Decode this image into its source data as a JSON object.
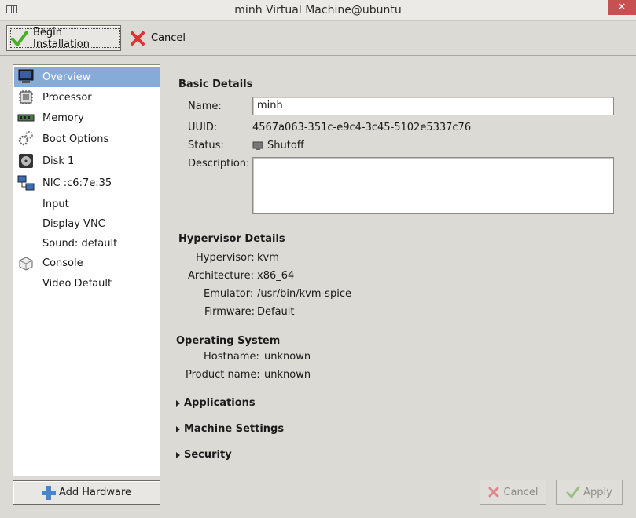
{
  "window": {
    "title": "minh Virtual Machine@ubuntu",
    "close_glyph": "✕"
  },
  "toolbar": {
    "begin_label": "Begin Installation",
    "cancel_label": "Cancel"
  },
  "sidebar": {
    "items": [
      {
        "label": "Overview",
        "icon": "monitor-icon"
      },
      {
        "label": "Processor",
        "icon": "cpu-icon"
      },
      {
        "label": "Memory",
        "icon": "memory-icon"
      },
      {
        "label": "Boot Options",
        "icon": "gears-icon"
      },
      {
        "label": "Disk 1",
        "icon": "disk-icon"
      },
      {
        "label": "NIC :c6:7e:35",
        "icon": "network-icon"
      },
      {
        "label": "Input",
        "icon": ""
      },
      {
        "label": "Display VNC",
        "icon": ""
      },
      {
        "label": "Sound: default",
        "icon": ""
      },
      {
        "label": "Console",
        "icon": "console-icon"
      },
      {
        "label": "Video Default",
        "icon": ""
      }
    ],
    "add_hardware_label": "Add Hardware"
  },
  "basic": {
    "heading": "Basic Details",
    "name_label": "Name:",
    "name_value": "minh",
    "uuid_label": "UUID:",
    "uuid_value": "4567a063-351c-e9c4-3c45-5102e5337c76",
    "status_label": "Status:",
    "status_value": "Shutoff",
    "description_label": "Description:",
    "description_value": ""
  },
  "hypervisor": {
    "heading": "Hypervisor Details",
    "hypervisor_label": "Hypervisor:",
    "hypervisor_value": "kvm",
    "arch_label": "Architecture:",
    "arch_value": "x86_64",
    "emulator_label": "Emulator:",
    "emulator_value": "/usr/bin/kvm-spice",
    "firmware_label": "Firmware:",
    "firmware_value": "Default"
  },
  "os": {
    "heading": "Operating System",
    "hostname_label": "Hostname:",
    "hostname_value": "unknown",
    "product_label": "Product name:",
    "product_value": "unknown"
  },
  "expanders": [
    "Applications",
    "Machine Settings",
    "Security"
  ],
  "footer": {
    "cancel_label": "Cancel",
    "apply_label": "Apply"
  },
  "colors": {
    "selection": "#86abd9",
    "background": "#dcdad5"
  }
}
